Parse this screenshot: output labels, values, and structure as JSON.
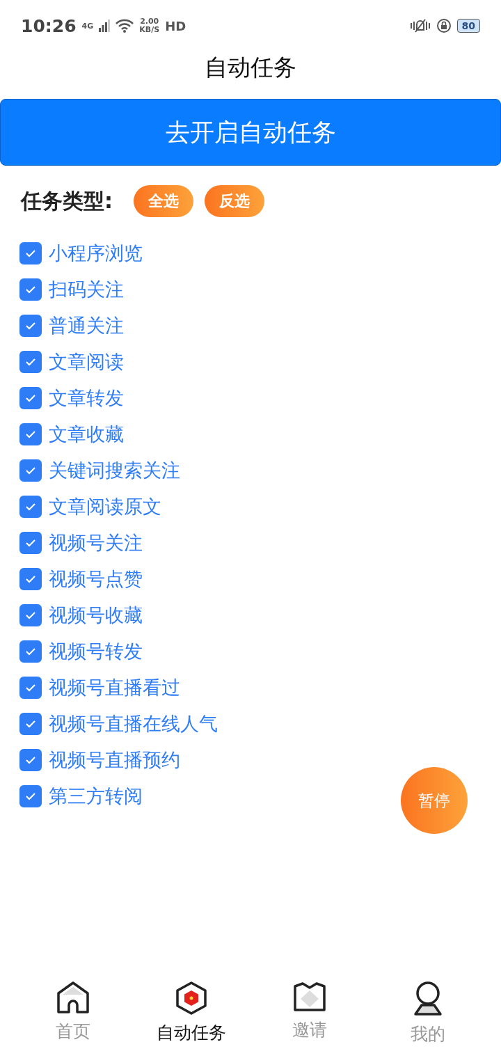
{
  "status_bar": {
    "time": "10:26",
    "network": "4G",
    "speed_value": "2.00",
    "speed_unit": "KB/S",
    "hd": "HD",
    "battery": "80"
  },
  "title": "自动任务",
  "start_button": "去开启自动任务",
  "task_type": {
    "label": "任务类型:",
    "buttons": [
      "全选",
      "反选"
    ]
  },
  "tasks": [
    {
      "label": "小程序浏览",
      "checked": true
    },
    {
      "label": "扫码关注",
      "checked": true
    },
    {
      "label": "普通关注",
      "checked": true
    },
    {
      "label": "文章阅读",
      "checked": true
    },
    {
      "label": "文章转发",
      "checked": true
    },
    {
      "label": "文章收藏",
      "checked": true
    },
    {
      "label": "关键词搜索关注",
      "checked": true
    },
    {
      "label": "文章阅读原文",
      "checked": true
    },
    {
      "label": "视频号关注",
      "checked": true
    },
    {
      "label": "视频号点赞",
      "checked": true
    },
    {
      "label": "视频号收藏",
      "checked": true
    },
    {
      "label": "视频号转发",
      "checked": true
    },
    {
      "label": "视频号直播看过",
      "checked": true
    },
    {
      "label": "视频号直播在线人气",
      "checked": true
    },
    {
      "label": "视频号直播预约",
      "checked": true
    },
    {
      "label": "第三方转阅",
      "checked": true
    }
  ],
  "pause_button": "暂停",
  "bottom_nav": [
    {
      "label": "首页",
      "kind": "home",
      "selected": false
    },
    {
      "label": "自动任务",
      "kind": "task",
      "selected": true
    },
    {
      "label": "邀请",
      "kind": "invite",
      "selected": false
    },
    {
      "label": "我的",
      "kind": "profile",
      "selected": false
    }
  ]
}
